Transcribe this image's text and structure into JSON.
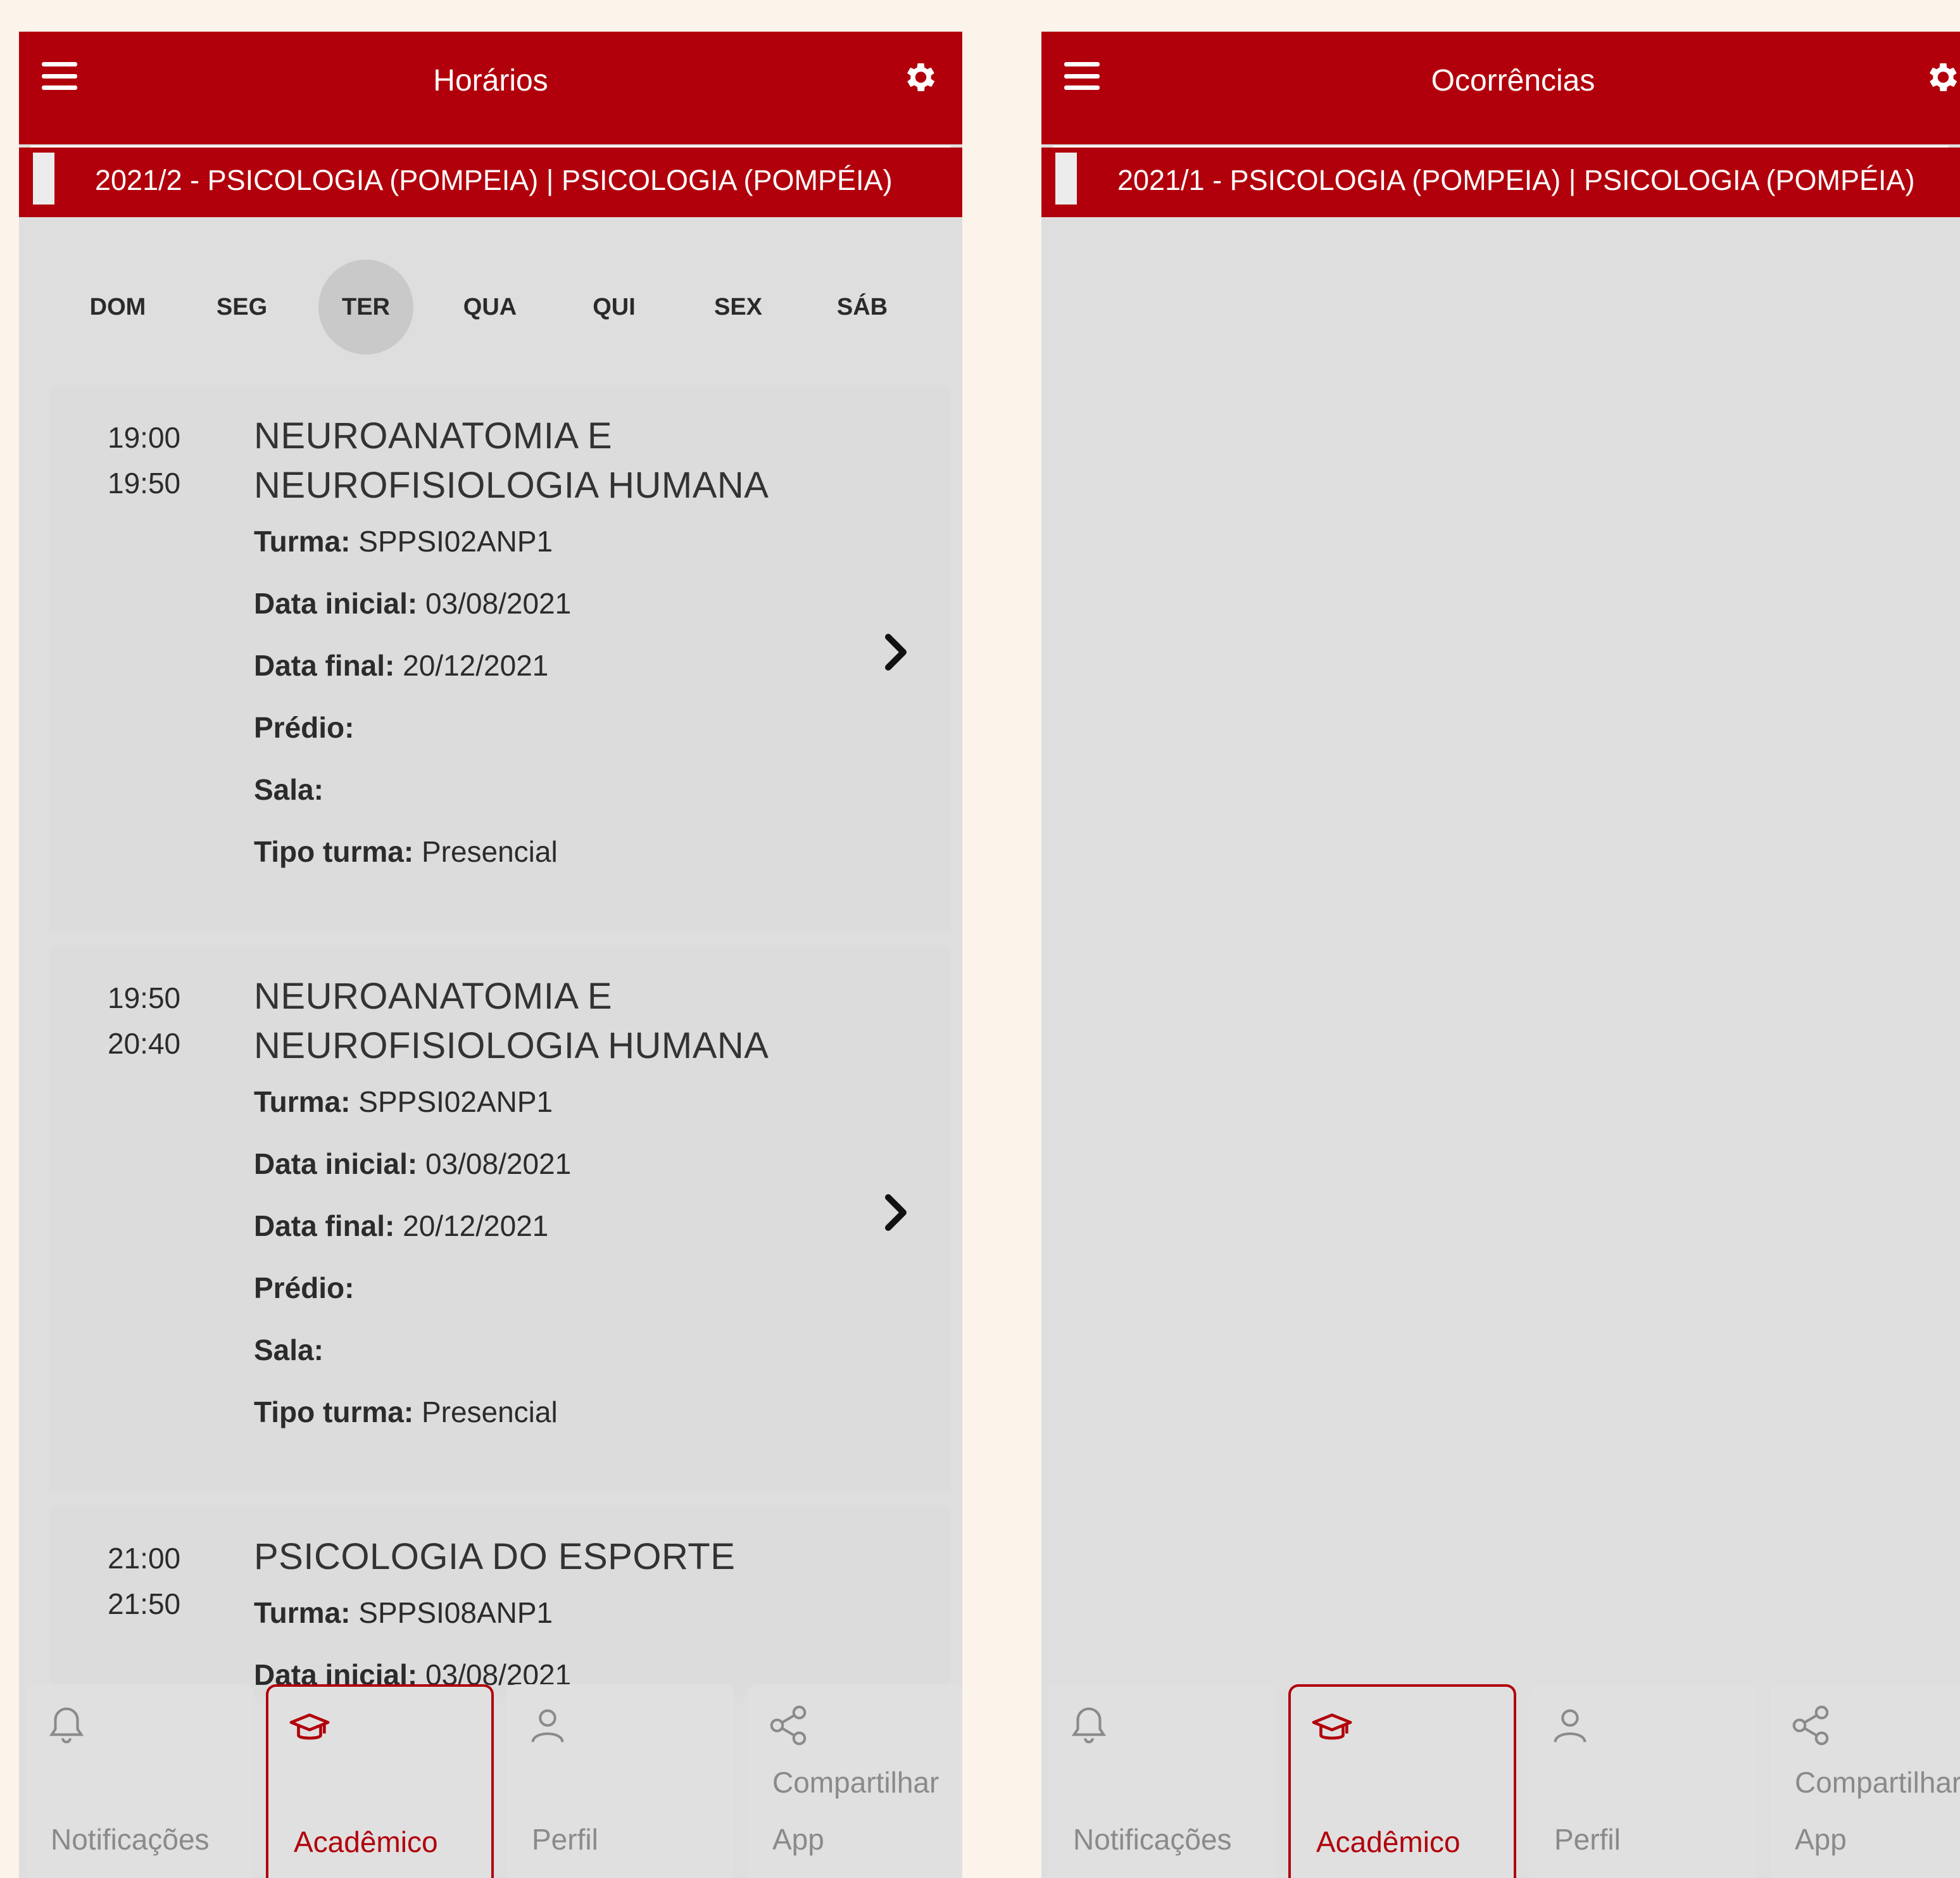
{
  "left": {
    "title": "Horários",
    "period": "2021/2 - PSICOLOGIA (POMPEIA) | PSICOLOGIA (POMPÉIA)",
    "days": [
      "DOM",
      "SEG",
      "TER",
      "QUA",
      "QUI",
      "SEX",
      "SÁB"
    ],
    "active_day": "TER",
    "entries": [
      {
        "start": "19:00",
        "end": "19:50",
        "subject_line1": "NEUROANATOMIA E",
        "subject_line2": "NEUROFISIOLOGIA HUMANA",
        "turma_label": "Turma:",
        "turma": "SPPSI02ANP1",
        "data_inicial_label": "Data inicial:",
        "data_inicial": "03/08/2021",
        "data_final_label": "Data final:",
        "data_final": "20/12/2021",
        "predio_label": "Prédio:",
        "predio": "",
        "sala_label": "Sala:",
        "sala": "",
        "tipo_label": "Tipo turma:",
        "tipo": "Presencial"
      },
      {
        "start": "19:50",
        "end": "20:40",
        "subject_line1": "NEUROANATOMIA E",
        "subject_line2": "NEUROFISIOLOGIA HUMANA",
        "turma_label": "Turma:",
        "turma": "SPPSI02ANP1",
        "data_inicial_label": "Data inicial:",
        "data_inicial": "03/08/2021",
        "data_final_label": "Data final:",
        "data_final": "20/12/2021",
        "predio_label": "Prédio:",
        "predio": "",
        "sala_label": "Sala:",
        "sala": "",
        "tipo_label": "Tipo turma:",
        "tipo": "Presencial"
      },
      {
        "start": "21:00",
        "end": "21:50",
        "subject_line1": "PSICOLOGIA DO ESPORTE",
        "turma_label": "Turma:",
        "turma": "SPPSI08ANP1",
        "data_inicial_label": "Data inicial:",
        "data_inicial": "03/08/2021"
      }
    ]
  },
  "right": {
    "title": "Ocorrências",
    "period": "2021/1 - PSICOLOGIA (POMPEIA) | PSICOLOGIA (POMPÉIA)"
  },
  "nav": {
    "notificacoes": "Notificações",
    "academico": "Acadêmico",
    "perfil": "Perfil",
    "compartilhar_line1": "Compartilhar",
    "compartilhar_line2": "App"
  },
  "colors": {
    "primary": "#b1000b",
    "content_bg": "#dedede",
    "page_bg": "#fcf3ea"
  },
  "icons": {
    "menu": "menu-icon",
    "settings": "gear-icon",
    "chevron": "chevron-right-icon",
    "notificacoes": "bell-icon",
    "academico": "graduation-cap-icon",
    "perfil": "person-icon",
    "compartilhar": "share-icon"
  }
}
